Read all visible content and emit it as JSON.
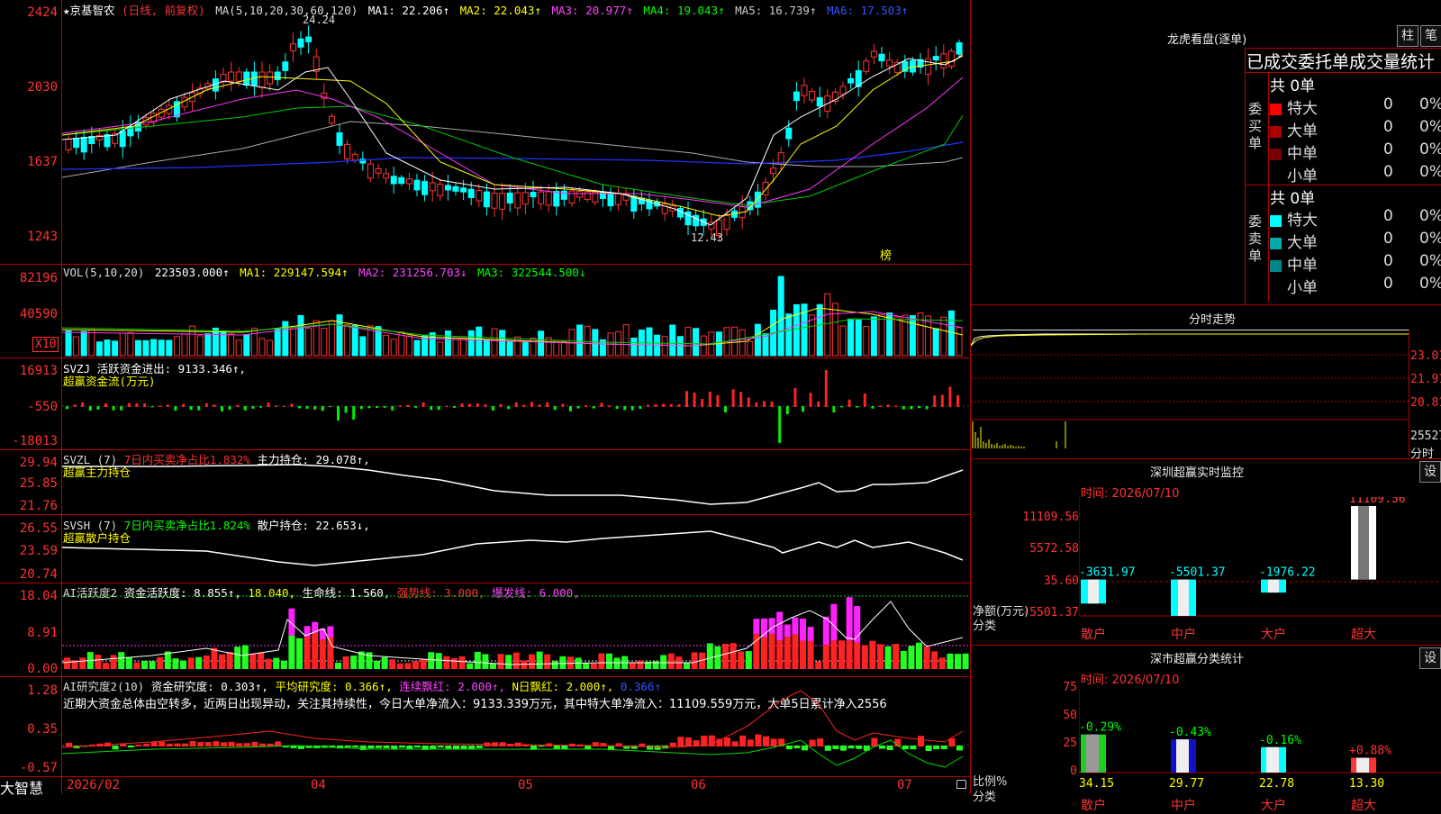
{
  "kline": {
    "title_prefix": "★京基智农",
    "mode": "(日线, 前复权)",
    "ma_label": "MA(5,10,20,30,60,120)",
    "ma": [
      {
        "label": "MA1: 22.206↑",
        "color": "#ffffff"
      },
      {
        "label": "MA2: 22.043↑",
        "color": "#ffff00"
      },
      {
        "label": "MA3: 20.977↑",
        "color": "#ff44ff"
      },
      {
        "label": "MA4: 19.043↑",
        "color": "#00ff00"
      },
      {
        "label": "MA5: 16.739↑",
        "color": "#bbbbbb"
      },
      {
        "label": "MA6: 17.503↑",
        "color": "#3355ff"
      }
    ],
    "y_ticks": [
      "2424",
      "2030",
      "1637",
      "1243"
    ],
    "high_marker": "24.24",
    "low_marker": "12.43",
    "bang_label": "榜"
  },
  "vol": {
    "header": "VOL(5,10,20)",
    "value": "223503.000↑",
    "ma1": "MA1: 229147.594↑",
    "ma2": "MA2: 231256.703↓",
    "ma3": "MA3: 322544.500↓",
    "y_ticks": [
      "82196",
      "40590"
    ],
    "unit": "X10"
  },
  "svzj": {
    "header": "SVZJ  活跃资金进出: 9133.346↑,",
    "sub": "超赢资金流(万元)",
    "y_ticks": [
      "16913",
      "-550",
      "-18013"
    ]
  },
  "svzl": {
    "header_a": "SVZL (7)",
    "header_b": "7日内买卖净占比1.832%",
    "header_c": "主力持仓: 29.078↑,",
    "sub": "超赢主力持仓",
    "y_ticks": [
      "29.94",
      "25.85",
      "21.76"
    ]
  },
  "svsh": {
    "header_a": "SVSH (7)",
    "header_b": "7日内买卖净占比1.824%",
    "header_c": "散户持仓: 22.653↓,",
    "sub": "超赢散户持仓",
    "y_ticks": [
      "26.55",
      "23.59",
      "20.74"
    ]
  },
  "ai_act": {
    "header_a": "AI活跃度2",
    "header_b": "资金活跃度: 8.855↑,",
    "header_c": "18.040,",
    "header_d": "生命线: 1.560,",
    "header_e": "强势线: 3.000,",
    "header_f": "爆发线: 6.000,",
    "y_ticks": [
      "18.04",
      "8.91",
      "0.00"
    ]
  },
  "ai_res": {
    "header_a": "AI研究度2(10)",
    "header_b": "资金研究度: 0.303↑,",
    "header_c": "平均研究度: 0.366↑,",
    "header_d": "连续飘红: 2.000↑,",
    "header_e": "N日飘红: 2.000↑,",
    "header_f": "0.366↑",
    "comment": "近期大资金总体由空转多，近两日出现异动，关注其持续性，今日大单净流入：9133.339万元，其中特大单净流入：11109.559万元，大单5日累计净入2556",
    "y_ticks": [
      "1.28",
      "0.35",
      "-0.57"
    ]
  },
  "timeline": {
    "brand": "大智慧",
    "labels": [
      "2026/02",
      "04",
      "05",
      "06",
      "07"
    ]
  },
  "dragon": {
    "title": "龙虎看盘(逐单)",
    "btn_zhu": "柱",
    "btn_bi": "笔",
    "header": "已成交委托单成交量统计",
    "buy_total": "共 0单",
    "buy_side": [
      "委",
      "买",
      "单"
    ],
    "sell_total": "共 0单",
    "sell_side": [
      "委",
      "卖",
      "单"
    ],
    "buy_rows": [
      {
        "label": "特大",
        "val": "0",
        "pct": "0%",
        "color": "#ff0000"
      },
      {
        "label": "大单",
        "val": "0",
        "pct": "0%",
        "color": "#aa0000"
      },
      {
        "label": "中单",
        "val": "0",
        "pct": "0%",
        "color": "#770000"
      },
      {
        "label": "小单",
        "val": "0",
        "pct": "0%",
        "color": ""
      }
    ],
    "sell_rows": [
      {
        "label": "特大",
        "val": "0",
        "pct": "0%",
        "color": "#00ffff"
      },
      {
        "label": "大单",
        "val": "0",
        "pct": "0%",
        "color": "#00aaaa"
      },
      {
        "label": "中单",
        "val": "0",
        "pct": "0%",
        "color": "#008888"
      },
      {
        "label": "小单",
        "val": "0",
        "pct": "0%",
        "color": ""
      }
    ]
  },
  "intraday": {
    "title": "分时走势",
    "y_ticks": [
      "23.01",
      "21.91",
      "20.81",
      "25527"
    ],
    "unit": "分时"
  },
  "monitor": {
    "title": "深圳超赢实时监控",
    "btn": "设",
    "time": "时间: 2026/07/10",
    "y_ticks": [
      "11109.56",
      "5572.58",
      "35.60",
      "-5501.37"
    ],
    "ylabel_a": "净额(万元)",
    "ylabel_b": "分类",
    "categories": [
      "散户",
      "中户",
      "大户",
      "超大"
    ],
    "values": [
      -3631.97,
      -5501.37,
      -1976.22,
      11109.56
    ],
    "value_labels": [
      "-3631.97",
      "-5501.37",
      "-1976.22",
      "11109.56"
    ]
  },
  "classify": {
    "title": "深市超赢分类统计",
    "btn": "设",
    "time": "时间: 2026/07/10",
    "y_ticks": [
      "75",
      "50",
      "25",
      "0"
    ],
    "ylabel_a": "比例%",
    "ylabel_b": "分类",
    "categories": [
      "散户",
      "中户",
      "大户",
      "超大"
    ],
    "values": [
      34.15,
      29.77,
      22.78,
      13.3
    ],
    "value_labels": [
      "34.15",
      "29.77",
      "22.78",
      "13.30"
    ],
    "changes": [
      "-0.29%",
      "-0.43%",
      "-0.16%",
      "+0.88%"
    ]
  },
  "chart_data": [
    {
      "type": "bar",
      "title": "深圳超赢实时监控",
      "ylabel": "净额(万元)",
      "xlabel": "分类",
      "categories": [
        "散户",
        "中户",
        "大户",
        "超大"
      ],
      "values": [
        -3631.97,
        -5501.37,
        -1976.22,
        11109.56
      ]
    },
    {
      "type": "bar",
      "title": "深市超赢分类统计",
      "ylabel": "比例%",
      "xlabel": "分类",
      "categories": [
        "散户",
        "中户",
        "大户",
        "超大"
      ],
      "values": [
        34.15,
        29.77,
        22.78,
        13.3
      ],
      "ylim": [
        0,
        75
      ]
    }
  ]
}
